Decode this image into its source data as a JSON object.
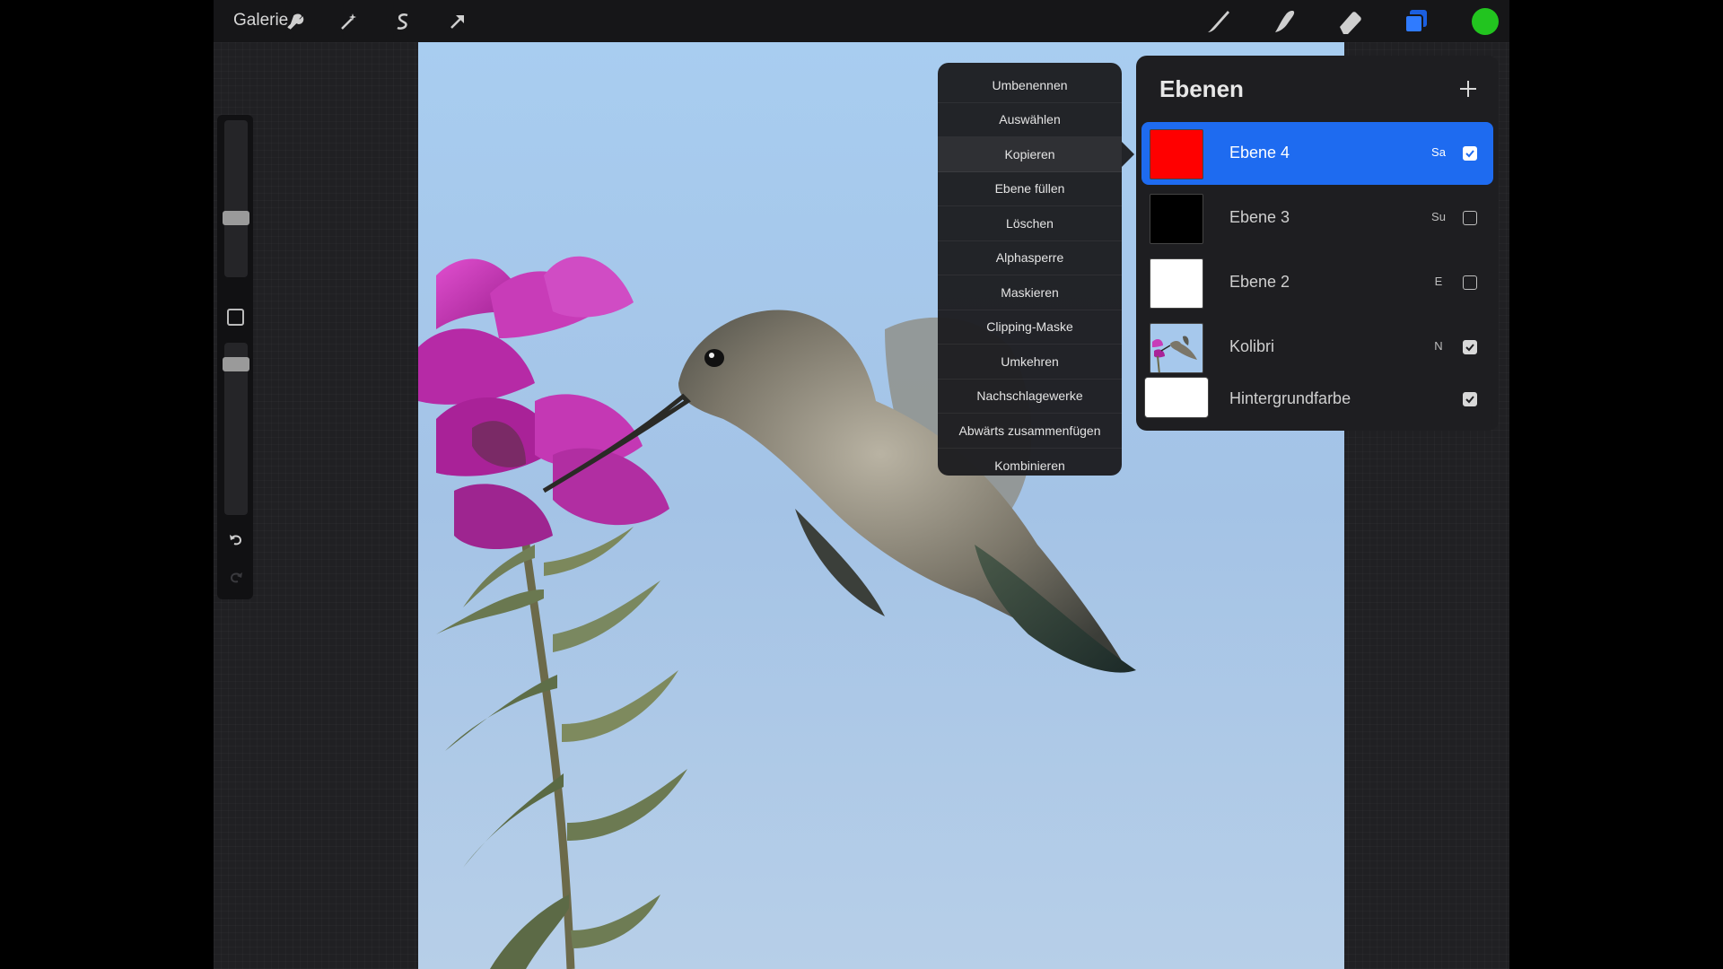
{
  "topbar": {
    "gallery_label": "Galerie",
    "left_tools": [
      "wrench-icon",
      "magic-wand-icon",
      "selection-s-icon",
      "transform-arrow-icon"
    ],
    "right_tools": [
      "brush-icon",
      "smudge-icon",
      "eraser-icon",
      "layers-icon"
    ],
    "current_color": "#22c41f"
  },
  "sidebar": {
    "icons": [
      "modify-square-icon",
      "undo-icon",
      "redo-icon"
    ]
  },
  "context_menu": {
    "items": [
      {
        "label": "Umbenennen"
      },
      {
        "label": "Auswählen"
      },
      {
        "label": "Kopieren"
      },
      {
        "label": "Ebene füllen"
      },
      {
        "label": "Löschen"
      },
      {
        "label": "Alphasperre"
      },
      {
        "label": "Maskieren"
      },
      {
        "label": "Clipping-Maske"
      },
      {
        "label": "Umkehren"
      },
      {
        "label": "Nachschlagewerke"
      },
      {
        "label": "Abwärts zusammenfügen"
      },
      {
        "label": "Kombinieren"
      }
    ]
  },
  "layers_panel": {
    "title": "Ebenen",
    "layers": [
      {
        "name": "Ebene 4",
        "mode": "Sa",
        "visible": true,
        "selected": true,
        "thumb_color": "#ff0000"
      },
      {
        "name": "Ebene 3",
        "mode": "Su",
        "visible": false,
        "selected": false,
        "thumb_color": "#000000"
      },
      {
        "name": "Ebene 2",
        "mode": "E",
        "visible": false,
        "selected": false,
        "thumb_color": "#ffffff"
      },
      {
        "name": "Kolibri",
        "mode": "N",
        "visible": true,
        "selected": false,
        "thumb_color": "image"
      },
      {
        "name": "Hintergrundfarbe",
        "mode": "",
        "visible": true,
        "selected": false,
        "thumb_color": "#ffffff"
      }
    ]
  },
  "colors": {
    "selected_layer": "#1e6bf0",
    "sky_top": "#9ec4ea",
    "flower": "#c832b4"
  }
}
